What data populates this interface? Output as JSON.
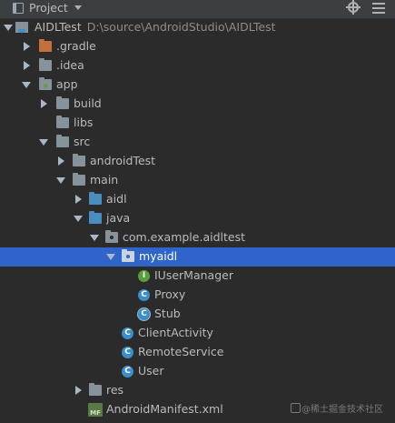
{
  "header": {
    "title": "Project"
  },
  "tree": [
    {
      "label": "AIDLTest",
      "path": "D:\\source\\AndroidStudio\\AIDLTest",
      "icon": "module-icon",
      "expanded": true
    },
    {
      "label": ".gradle",
      "icon": "folder-orange-icon",
      "expanded": false
    },
    {
      "label": ".idea",
      "icon": "folder-icon",
      "expanded": false
    },
    {
      "label": "app",
      "icon": "module-folder-icon",
      "expanded": true
    },
    {
      "label": "build",
      "icon": "folder-icon",
      "expanded": false
    },
    {
      "label": "libs",
      "icon": "folder-icon"
    },
    {
      "label": "src",
      "icon": "folder-icon",
      "expanded": true
    },
    {
      "label": "androidTest",
      "icon": "folder-icon",
      "expanded": false
    },
    {
      "label": "main",
      "icon": "folder-icon",
      "expanded": true
    },
    {
      "label": "aidl",
      "icon": "folder-blue-icon",
      "expanded": false
    },
    {
      "label": "java",
      "icon": "folder-blue-icon",
      "expanded": true
    },
    {
      "label": "com.example.aidltest",
      "icon": "package-icon",
      "expanded": true
    },
    {
      "label": "myaidl",
      "icon": "package-icon",
      "expanded": true,
      "selected": true
    },
    {
      "label": "IUserManager",
      "icon": "interface-icon",
      "badge": "I"
    },
    {
      "label": "Proxy",
      "icon": "class-icon",
      "badge": "C"
    },
    {
      "label": "Stub",
      "icon": "class-icon",
      "badge": "C"
    },
    {
      "label": "ClientActivity",
      "icon": "class-icon",
      "badge": "C"
    },
    {
      "label": "RemoteService",
      "icon": "class-icon",
      "badge": "C"
    },
    {
      "label": "User",
      "icon": "class-icon",
      "badge": "C"
    },
    {
      "label": "res",
      "icon": "folder-icon",
      "expanded": false
    },
    {
      "label": "AndroidManifest.xml",
      "icon": "manifest-icon",
      "badge": "MF"
    }
  ],
  "watermark": "@稀土掘金技术社区",
  "colors": {
    "background": "#2b2b2b",
    "header": "#3c3f41",
    "selection": "#2f65ca",
    "text": "#bbbbbb"
  }
}
